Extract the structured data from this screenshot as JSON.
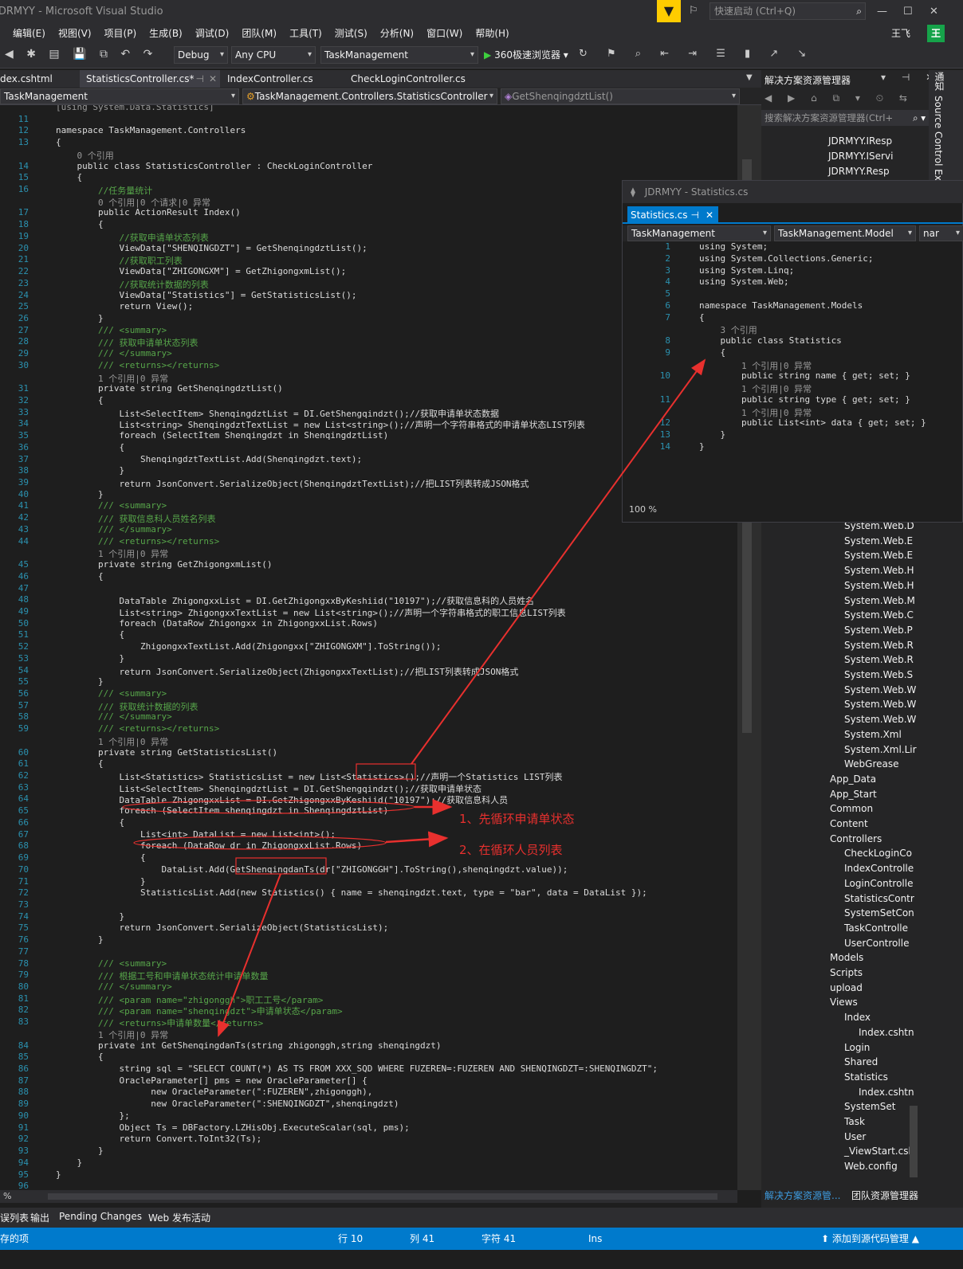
{
  "window": {
    "title": "JDRMYY - Microsoft Visual Studio",
    "quick_launch": "快速启动 (Ctrl+Q)",
    "user": "王飞",
    "avatar": "王"
  },
  "menu": [
    "编辑(E)",
    "视图(V)",
    "项目(P)",
    "生成(B)",
    "调试(D)",
    "团队(M)",
    "工具(T)",
    "测试(S)",
    "分析(N)",
    "窗口(W)",
    "帮助(H)"
  ],
  "toolbar": {
    "config": "Debug",
    "platform": "Any CPU",
    "project": "TaskManagement",
    "browser": "360极速浏览器"
  },
  "tabs": [
    "dex.cshtml",
    "StatisticsController.cs*",
    "IndexController.cs",
    "CheckLoginController.cs"
  ],
  "nav": {
    "project": "TaskManagement",
    "class": "TaskManagement.Controllers.StatisticsController",
    "member": "GetShenqingdztList()"
  },
  "code_lines": [
    [
      "",
      "[using System.Data.Statistics]",
      "ref"
    ],
    [
      "11",
      "",
      ""
    ],
    [
      "12",
      "namespace TaskManagement.Controllers",
      "kw"
    ],
    [
      "13",
      "{",
      ""
    ],
    [
      "",
      "    0 个引用",
      "ref"
    ],
    [
      "14",
      "    public class StatisticsController : CheckLoginController",
      "kw"
    ],
    [
      "15",
      "    {",
      ""
    ],
    [
      "16",
      "        //任务量统计",
      "cm"
    ],
    [
      "",
      "        0 个引用|0 个请求|0 异常",
      "ref"
    ],
    [
      "17",
      "        public ActionResult Index()",
      "kw"
    ],
    [
      "18",
      "        {",
      ""
    ],
    [
      "19",
      "            //获取申请单状态列表",
      "cm"
    ],
    [
      "20",
      "            ViewData[\"SHENQINGDZT\"] = GetShenqingdztList();",
      ""
    ],
    [
      "21",
      "            //获取职工列表",
      "cm"
    ],
    [
      "22",
      "            ViewData[\"ZHIGONGXM\"] = GetZhigongxmList();",
      ""
    ],
    [
      "23",
      "            //获取统计数据的列表",
      "cm"
    ],
    [
      "24",
      "            ViewData[\"Statistics\"] = GetStatisticsList();",
      ""
    ],
    [
      "25",
      "            return View();",
      ""
    ],
    [
      "26",
      "        }",
      ""
    ],
    [
      "27",
      "        /// <summary>",
      "dc"
    ],
    [
      "28",
      "        /// 获取申请单状态列表",
      "dc"
    ],
    [
      "29",
      "        /// </summary>",
      "dc"
    ],
    [
      "30",
      "        /// <returns></returns>",
      "dc"
    ],
    [
      "",
      "        1 个引用|0 异常",
      "ref"
    ],
    [
      "31",
      "        private string GetShenqingdztList()",
      "kw"
    ],
    [
      "32",
      "        {",
      ""
    ],
    [
      "33",
      "            List<SelectItem> ShenqingdztList = DI.GetShengqindzt();//获取申请单状态数据",
      ""
    ],
    [
      "34",
      "            List<string> ShenqingdztTextList = new List<string>();//声明一个字符串格式的申请单状态LIST列表",
      ""
    ],
    [
      "35",
      "            foreach (SelectItem Shenqingdzt in ShenqingdztList)",
      ""
    ],
    [
      "36",
      "            {",
      ""
    ],
    [
      "37",
      "                ShenqingdztTextList.Add(Shenqingdzt.text);",
      ""
    ],
    [
      "38",
      "            }",
      ""
    ],
    [
      "39",
      "            return JsonConvert.SerializeObject(ShenqingdztTextList);//把LIST列表转成JSON格式",
      ""
    ],
    [
      "40",
      "        }",
      ""
    ],
    [
      "41",
      "        /// <summary>",
      "dc"
    ],
    [
      "42",
      "        /// 获取信息科人员姓名列表",
      "dc"
    ],
    [
      "43",
      "        /// </summary>",
      "dc"
    ],
    [
      "44",
      "        /// <returns></returns>",
      "dc"
    ],
    [
      "",
      "        1 个引用|0 异常",
      "ref"
    ],
    [
      "45",
      "        private string GetZhigongxmList()",
      "kw"
    ],
    [
      "46",
      "        {",
      ""
    ],
    [
      "47",
      "",
      ""
    ],
    [
      "48",
      "            DataTable ZhigongxxList = DI.GetZhigongxxByKeshiid(\"10197\");//获取信息科的人员姓名",
      ""
    ],
    [
      "49",
      "            List<string> ZhigongxxTextList = new List<string>();//声明一个字符串格式的职工信息LIST列表",
      ""
    ],
    [
      "50",
      "            foreach (DataRow Zhigongxx in ZhigongxxList.Rows)",
      ""
    ],
    [
      "51",
      "            {",
      ""
    ],
    [
      "52",
      "                ZhigongxxTextList.Add(Zhigongxx[\"ZHIGONGXM\"].ToString());",
      ""
    ],
    [
      "53",
      "            }",
      ""
    ],
    [
      "54",
      "            return JsonConvert.SerializeObject(ZhigongxxTextList);//把LIST列表转成JSON格式",
      ""
    ],
    [
      "55",
      "        }",
      ""
    ],
    [
      "56",
      "        /// <summary>",
      "dc"
    ],
    [
      "57",
      "        /// 获取统计数据的列表",
      "dc"
    ],
    [
      "58",
      "        /// </summary>",
      "dc"
    ],
    [
      "59",
      "        /// <returns></returns>",
      "dc"
    ],
    [
      "",
      "        1 个引用|0 异常",
      "ref"
    ],
    [
      "60",
      "        private string GetStatisticsList()",
      "kw"
    ],
    [
      "61",
      "        {",
      ""
    ],
    [
      "62",
      "            List<Statistics> StatisticsList = new List<Statistics>();//声明一个Statistics LIST列表",
      ""
    ],
    [
      "63",
      "            List<SelectItem> ShenqingdztList = DI.GetShengqindzt();//获取申请单状态",
      ""
    ],
    [
      "64",
      "            DataTable ZhigongxxList = DI.GetZhigongxxByKeshiid(\"10197\");//获取信息科人员",
      ""
    ],
    [
      "65",
      "            foreach (SelectItem shenqingdzt in ShenqingdztList)",
      ""
    ],
    [
      "66",
      "            {",
      ""
    ],
    [
      "67",
      "                List<int> DataList = new List<int>();",
      ""
    ],
    [
      "68",
      "                foreach (DataRow dr in ZhigongxxList.Rows)",
      ""
    ],
    [
      "69",
      "                {",
      ""
    ],
    [
      "70",
      "                    DataList.Add(GetShenqingdanTs(dr[\"ZHIGONGGH\"].ToString(),shenqingdzt.value));",
      ""
    ],
    [
      "71",
      "                }",
      ""
    ],
    [
      "72",
      "                StatisticsList.Add(new Statistics() { name = shenqingdzt.text, type = \"bar\", data = DataList });",
      ""
    ],
    [
      "73",
      "",
      ""
    ],
    [
      "74",
      "            }",
      ""
    ],
    [
      "75",
      "            return JsonConvert.SerializeObject(StatisticsList);",
      ""
    ],
    [
      "76",
      "        }",
      ""
    ],
    [
      "77",
      "",
      ""
    ],
    [
      "78",
      "        /// <summary>",
      "dc"
    ],
    [
      "79",
      "        /// 根据工号和申请单状态统计申请单数量",
      "dc"
    ],
    [
      "80",
      "        /// </summary>",
      "dc"
    ],
    [
      "81",
      "        /// <param name=\"zhigonggh\">职工工号</param>",
      "dc"
    ],
    [
      "82",
      "        /// <param name=\"shenqingdzt\">申请单状态</param>",
      "dc"
    ],
    [
      "83",
      "        /// <returns>申请单数量</returns>",
      "dc"
    ],
    [
      "",
      "        1 个引用|0 异常",
      "ref"
    ],
    [
      "84",
      "        private int GetShenqingdanTs(string zhigonggh,string shenqingdzt)",
      "kw"
    ],
    [
      "85",
      "        {",
      ""
    ],
    [
      "86",
      "            string sql = \"SELECT COUNT(*) AS TS FROM XXX_SQD WHERE FUZEREN=:FUZEREN AND SHENQINGDZT=:SHENQINGDZT\";",
      ""
    ],
    [
      "87",
      "            OracleParameter[] pms = new OracleParameter[] {",
      ""
    ],
    [
      "88",
      "                  new OracleParameter(\":FUZEREN\",zhigonggh),",
      ""
    ],
    [
      "89",
      "                  new OracleParameter(\":SHENQINGDZT\",shenqingdzt)",
      ""
    ],
    [
      "90",
      "            };",
      ""
    ],
    [
      "91",
      "            Object Ts = DBFactory.LZHisObj.ExecuteScalar(sql, pms);",
      ""
    ],
    [
      "92",
      "            return Convert.ToInt32(Ts);",
      ""
    ],
    [
      "93",
      "        }",
      ""
    ],
    [
      "94",
      "    }",
      ""
    ],
    [
      "95",
      "}",
      ""
    ],
    [
      "96",
      "",
      ""
    ]
  ],
  "float_window": {
    "title": "JDRMYY - Statistics.cs",
    "tab": "Statistics.cs",
    "nav1": "TaskManagement",
    "nav2": "TaskManagement.Model",
    "nav3": "nar",
    "zoom": "100 %",
    "lines": [
      [
        "1",
        "using System;",
        "kw"
      ],
      [
        "2",
        "using System.Collections.Generic;",
        "kw"
      ],
      [
        "3",
        "using System.Linq;",
        "kw"
      ],
      [
        "4",
        "using System.Web;",
        "kw"
      ],
      [
        "5",
        "",
        ""
      ],
      [
        "6",
        "namespace TaskManagement.Models",
        "kw"
      ],
      [
        "7",
        "{",
        ""
      ],
      [
        "",
        "    3 个引用",
        "ref"
      ],
      [
        "8",
        "    public class Statistics",
        "kw"
      ],
      [
        "9",
        "    {",
        ""
      ],
      [
        "",
        "        1 个引用|0 异常",
        "ref"
      ],
      [
        "10",
        "        public string name { get; set; }",
        "kw"
      ],
      [
        "",
        "        1 个引用|0 异常",
        "ref"
      ],
      [
        "11",
        "        public string type { get; set; }",
        "kw"
      ],
      [
        "",
        "        1 个引用|0 异常",
        "ref"
      ],
      [
        "12",
        "        public List<int> data { get; set; }",
        "kw"
      ],
      [
        "13",
        "    }",
        ""
      ],
      [
        "14",
        "}",
        ""
      ]
    ]
  },
  "solution": {
    "title": "解决方案资源管理器",
    "search": "搜索解决方案资源管理器(Ctrl+",
    "top_items": [
      "JDRMYY.IResp",
      "JDRMYY.IServi",
      "JDRMYY.Resp"
    ],
    "items": [
      "System.Web.D",
      "System.Web.E",
      "System.Web.E",
      "System.Web.H",
      "System.Web.H",
      "System.Web.M",
      "System.Web.C",
      "System.Web.P",
      "System.Web.R",
      "System.Web.R",
      "System.Web.S",
      "System.Web.W",
      "System.Web.W",
      "System.Web.W",
      "System.Xml",
      "System.Xml.Lir",
      "WebGrease",
      "App_Data",
      "App_Start",
      "Common",
      "Content",
      "Controllers",
      "CheckLoginCo",
      "IndexControlle",
      "LoginControlle",
      "StatisticsContr",
      "SystemSetCon",
      "TaskControlle",
      "UserControlle",
      "Models",
      "Scripts",
      "upload",
      "Views",
      "Index",
      "Index.cshtn",
      "Login",
      "Shared",
      "Statistics",
      "Index.cshtn",
      "SystemSet",
      "Task",
      "User",
      "_ViewStart.csh",
      "Web.config"
    ],
    "tab1": "解决方案资源管...",
    "tab2": "团队资源管理器",
    "side_label": "Source Control Ex",
    "side_label2": "通知"
  },
  "bottom_tabs": [
    "误列表",
    "输出",
    "Pending Changes",
    "Web 发布活动"
  ],
  "status": {
    "left": "存的项",
    "line": "行 10",
    "col": "列 41",
    "ch": "字符 41",
    "mode": "Ins",
    "source": "添加到源代码管理"
  },
  "annotations": {
    "a1": "1、先循环申请单状态",
    "a2": "2、在循环人员列表"
  },
  "editor_zoom": "%"
}
